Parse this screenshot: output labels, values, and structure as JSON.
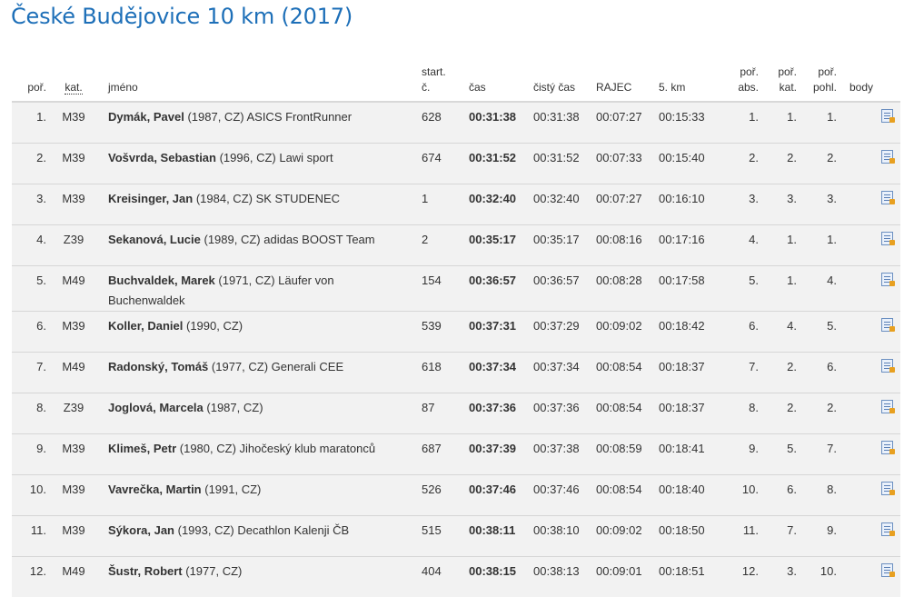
{
  "page": {
    "title": "České Budějovice 10 km (2017)"
  },
  "table": {
    "headers": {
      "por": "poř.",
      "kat": "kat.",
      "jmeno": "jméno",
      "start_line1": "start.",
      "start_line2": "č.",
      "cas": "čas",
      "cisty_cas": "čistý čas",
      "rajec": "RAJEC",
      "km5": "5. km",
      "por_abs_line1": "poř.",
      "por_abs_line2": "abs.",
      "por_kat_line1": "poř.",
      "por_kat_line2": "kat.",
      "por_pohl_line1": "poř.",
      "por_pohl_line2": "pohl.",
      "body": "body"
    },
    "rows": [
      {
        "por": "1.",
        "kat": "M39",
        "name": "Dymák, Pavel",
        "info": " (1987, CZ) ASICS FrontRunner",
        "start": "628",
        "cas": "00:31:38",
        "cisty": "00:31:38",
        "rajec": "00:07:27",
        "km5": "00:15:33",
        "abs": "1.",
        "pkat": "1.",
        "pohl": "1.",
        "body": ""
      },
      {
        "por": "2.",
        "kat": "M39",
        "name": "Vošvrda, Sebastian",
        "info": " (1996, CZ) Lawi sport",
        "start": "674",
        "cas": "00:31:52",
        "cisty": "00:31:52",
        "rajec": "00:07:33",
        "km5": "00:15:40",
        "abs": "2.",
        "pkat": "2.",
        "pohl": "2.",
        "body": ""
      },
      {
        "por": "3.",
        "kat": "M39",
        "name": "Kreisinger, Jan",
        "info": " (1984, CZ) SK STUDENEC",
        "start": "1",
        "cas": "00:32:40",
        "cisty": "00:32:40",
        "rajec": "00:07:27",
        "km5": "00:16:10",
        "abs": "3.",
        "pkat": "3.",
        "pohl": "3.",
        "body": ""
      },
      {
        "por": "4.",
        "kat": "Z39",
        "name": "Sekanová, Lucie",
        "info": " (1989, CZ) adidas BOOST Team",
        "start": "2",
        "cas": "00:35:17",
        "cisty": "00:35:17",
        "rajec": "00:08:16",
        "km5": "00:17:16",
        "abs": "4.",
        "pkat": "1.",
        "pohl": "1.",
        "body": ""
      },
      {
        "por": "5.",
        "kat": "M49",
        "name": "Buchvaldek, Marek",
        "info": " (1971, CZ) Läufer von Buchenwaldek",
        "start": "154",
        "cas": "00:36:57",
        "cisty": "00:36:57",
        "rajec": "00:08:28",
        "km5": "00:17:58",
        "abs": "5.",
        "pkat": "1.",
        "pohl": "4.",
        "body": ""
      },
      {
        "por": "6.",
        "kat": "M39",
        "name": "Koller, Daniel",
        "info": " (1990, CZ)",
        "start": "539",
        "cas": "00:37:31",
        "cisty": "00:37:29",
        "rajec": "00:09:02",
        "km5": "00:18:42",
        "abs": "6.",
        "pkat": "4.",
        "pohl": "5.",
        "body": ""
      },
      {
        "por": "7.",
        "kat": "M49",
        "name": "Radonský, Tomáš",
        "info": " (1977, CZ) Generali CEE",
        "start": "618",
        "cas": "00:37:34",
        "cisty": "00:37:34",
        "rajec": "00:08:54",
        "km5": "00:18:37",
        "abs": "7.",
        "pkat": "2.",
        "pohl": "6.",
        "body": ""
      },
      {
        "por": "8.",
        "kat": "Z39",
        "name": "Joglová, Marcela",
        "info": " (1987, CZ)",
        "start": "87",
        "cas": "00:37:36",
        "cisty": "00:37:36",
        "rajec": "00:08:54",
        "km5": "00:18:37",
        "abs": "8.",
        "pkat": "2.",
        "pohl": "2.",
        "body": ""
      },
      {
        "por": "9.",
        "kat": "M39",
        "name": "Klimeš, Petr",
        "info": " (1980, CZ) Jihočeský klub maratonců",
        "start": "687",
        "cas": "00:37:39",
        "cisty": "00:37:38",
        "rajec": "00:08:59",
        "km5": "00:18:41",
        "abs": "9.",
        "pkat": "5.",
        "pohl": "7.",
        "body": ""
      },
      {
        "por": "10.",
        "kat": "M39",
        "name": "Vavrečka, Martin",
        "info": " (1991, CZ)",
        "start": "526",
        "cas": "00:37:46",
        "cisty": "00:37:46",
        "rajec": "00:08:54",
        "km5": "00:18:40",
        "abs": "10.",
        "pkat": "6.",
        "pohl": "8.",
        "body": ""
      },
      {
        "por": "11.",
        "kat": "M39",
        "name": "Sýkora, Jan",
        "info": " (1993, CZ) Decathlon Kalenji ČB",
        "start": "515",
        "cas": "00:38:11",
        "cisty": "00:38:10",
        "rajec": "00:09:02",
        "km5": "00:18:50",
        "abs": "11.",
        "pkat": "7.",
        "pohl": "9.",
        "body": ""
      },
      {
        "por": "12.",
        "kat": "M49",
        "name": "Šustr, Robert",
        "info": " (1977, CZ)",
        "start": "404",
        "cas": "00:38:15",
        "cisty": "00:38:13",
        "rajec": "00:09:01",
        "km5": "00:18:51",
        "abs": "12.",
        "pkat": "3.",
        "pohl": "10.",
        "body": ""
      }
    ],
    "row_icon": "certificate-pdf-icon"
  },
  "colors": {
    "title": "#1d6fb8",
    "row_bg": "#f2f2f2",
    "row_border": "#d6d6d6"
  }
}
